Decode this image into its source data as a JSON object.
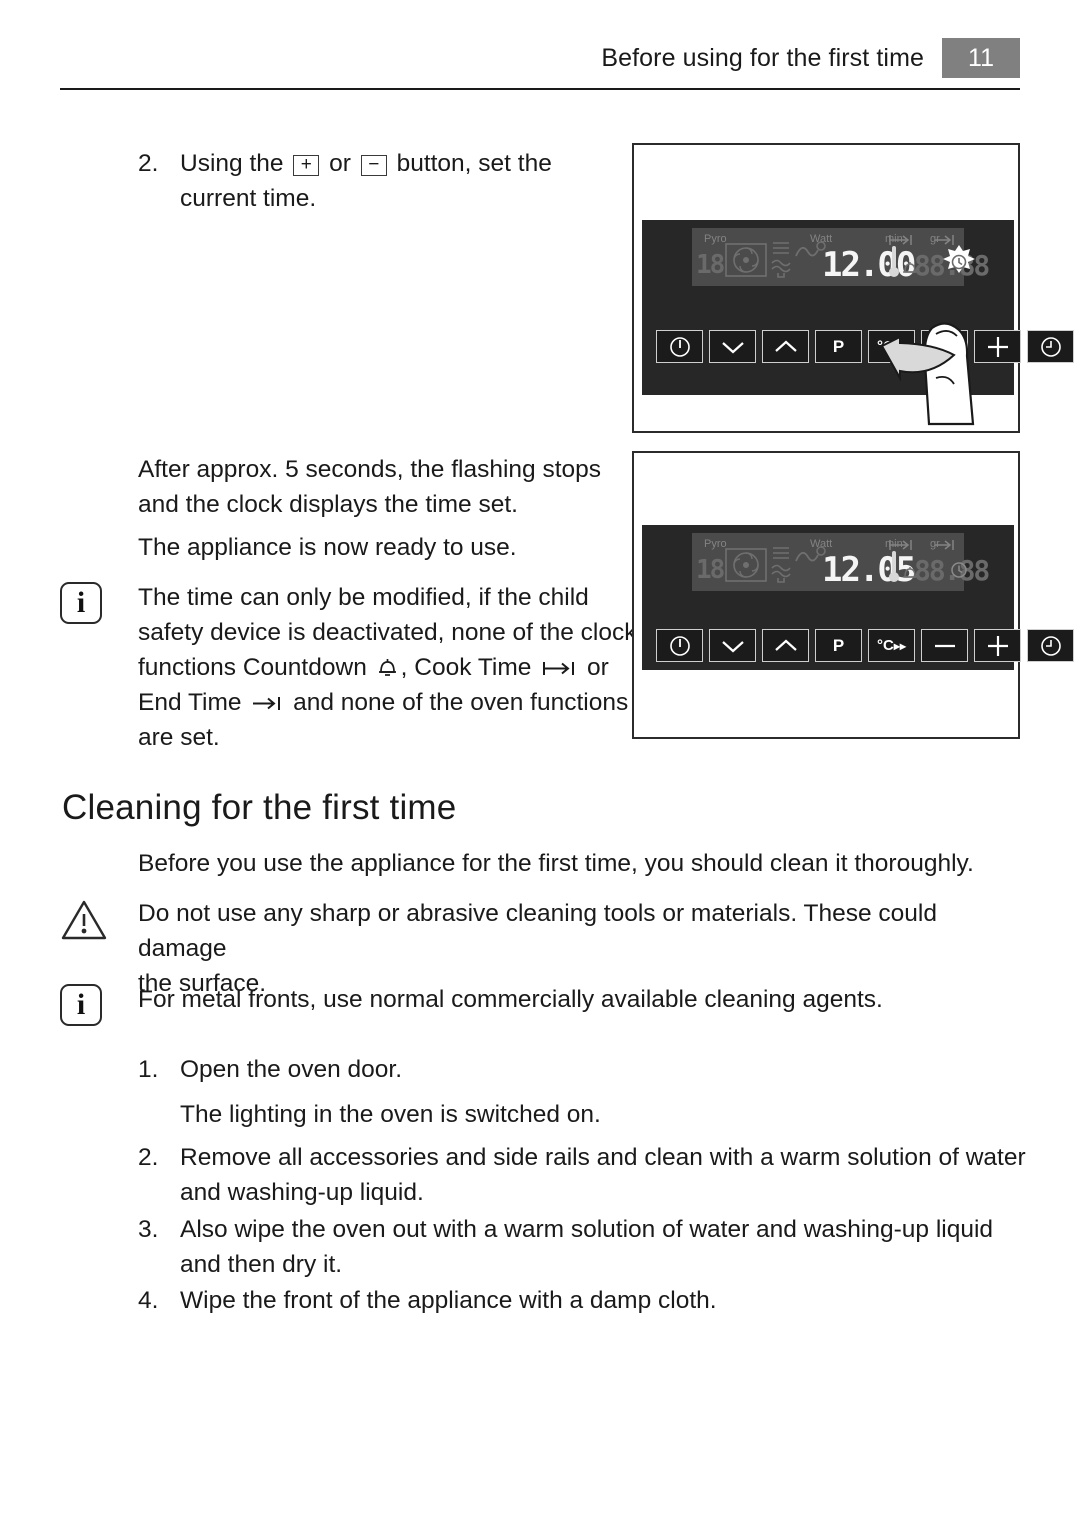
{
  "header": {
    "title": "Before using for the first time",
    "page_number": "11"
  },
  "steps_top": [
    {
      "number": "2.",
      "text_before": "Using the",
      "key_plus": "+",
      "text_middle": "or",
      "key_minus": "−",
      "text_after": "button, set the",
      "line2": "current time."
    }
  ],
  "paragraphs": {
    "after_5s_line1": "After approx. 5 seconds, the flashing stops",
    "after_5s_line2": "and the clock displays the time set.",
    "ready": "The appliance is now ready to use."
  },
  "note_child_safety": {
    "icon": "info-icon",
    "line1": "The time can only be modified, if the child",
    "line2": "safety device is deactivated, none of the clock",
    "line3_a": "functions Countdown",
    "icon_countdown": "bell-icon",
    "line3_b": ", Cook Time",
    "icon_cook_time": "cook-time-icon",
    "line3_c": "or",
    "line4_a": "End Time",
    "icon_end_time": "end-time-icon",
    "line4_b": "and none of the oven functions",
    "line5": "are set."
  },
  "section": {
    "heading": "Cleaning for the first time",
    "intro": "Before you use the appliance for the first time, you should clean it thoroughly."
  },
  "note_warning": {
    "icon": "warning-triangle-icon",
    "line1": "Do not use any sharp or abrasive cleaning tools or materials. These could damage",
    "line2": "the surface."
  },
  "note_metal_fronts": {
    "icon": "info-icon",
    "line1": "For metal fronts, use normal commercially available cleaning agents."
  },
  "cleaning_steps": [
    {
      "number": "1.",
      "line1": "Open the oven door.",
      "sub": "The lighting in the oven is switched on."
    },
    {
      "number": "2.",
      "line1": "Remove all accessories and side rails and clean with a warm solution of water",
      "line2": "and washing-up liquid."
    },
    {
      "number": "3.",
      "line1": "Also wipe the oven out with a warm solution of water and washing-up liquid",
      "line2": "and then dry it."
    },
    {
      "number": "4.",
      "line1": "Wipe the front of the appliance with a damp cloth.",
      "line2": ""
    }
  ],
  "figures": [
    {
      "id": "figure-set-time",
      "display": {
        "time": "12.00",
        "time_lit": true,
        "left_digits": "18",
        "right_digits": "88.88",
        "labels": {
          "pyro": "Pyro",
          "watt": "Watt",
          "min": "min",
          "gr": "gr"
        },
        "icons": [
          "fan-icon",
          "heating-element-icon",
          "probe-icon",
          "thermometer-icon",
          "cook-time-icon",
          "end-time-icon",
          "bell-icon"
        ],
        "clock_flashing": true
      },
      "buttons": [
        {
          "name": "power-button",
          "glyph": "Ⓘ"
        },
        {
          "name": "down-button",
          "glyph": "∨"
        },
        {
          "name": "up-button",
          "glyph": "∧"
        },
        {
          "name": "pyrolytic-button",
          "glyph": "P"
        },
        {
          "name": "temperature-button",
          "glyph": "°C▸▸"
        },
        {
          "name": "minus-button",
          "glyph": "−"
        },
        {
          "name": "plus-button",
          "glyph": "+"
        },
        {
          "name": "clock-button",
          "glyph": "◴"
        }
      ],
      "hand_pointing_at": "plus-button"
    },
    {
      "id": "figure-time-set",
      "display": {
        "time": "12.05",
        "time_lit": true,
        "left_digits": "18",
        "right_digits": "88.88",
        "labels": {
          "pyro": "Pyro",
          "watt": "Watt",
          "min": "min",
          "gr": "gr"
        },
        "icons": [
          "fan-icon",
          "heating-element-icon",
          "probe-icon",
          "thermometer-icon",
          "cook-time-icon",
          "end-time-icon",
          "bell-icon"
        ],
        "clock_flashing": false
      },
      "buttons": [
        {
          "name": "power-button",
          "glyph": "Ⓘ"
        },
        {
          "name": "down-button",
          "glyph": "∨"
        },
        {
          "name": "up-button",
          "glyph": "∧"
        },
        {
          "name": "pyrolytic-button",
          "glyph": "P"
        },
        {
          "name": "temperature-button",
          "glyph": "°C▸▸"
        },
        {
          "name": "minus-button",
          "glyph": "−"
        },
        {
          "name": "plus-button",
          "glyph": "+"
        },
        {
          "name": "clock-button",
          "glyph": "◴"
        }
      ],
      "hand_pointing_at": null
    }
  ],
  "colors": {
    "badge_gray": "#808080",
    "panel_black": "#272727",
    "lcd_gray": "#4b4b4b",
    "text_black": "#1a1a1a"
  }
}
